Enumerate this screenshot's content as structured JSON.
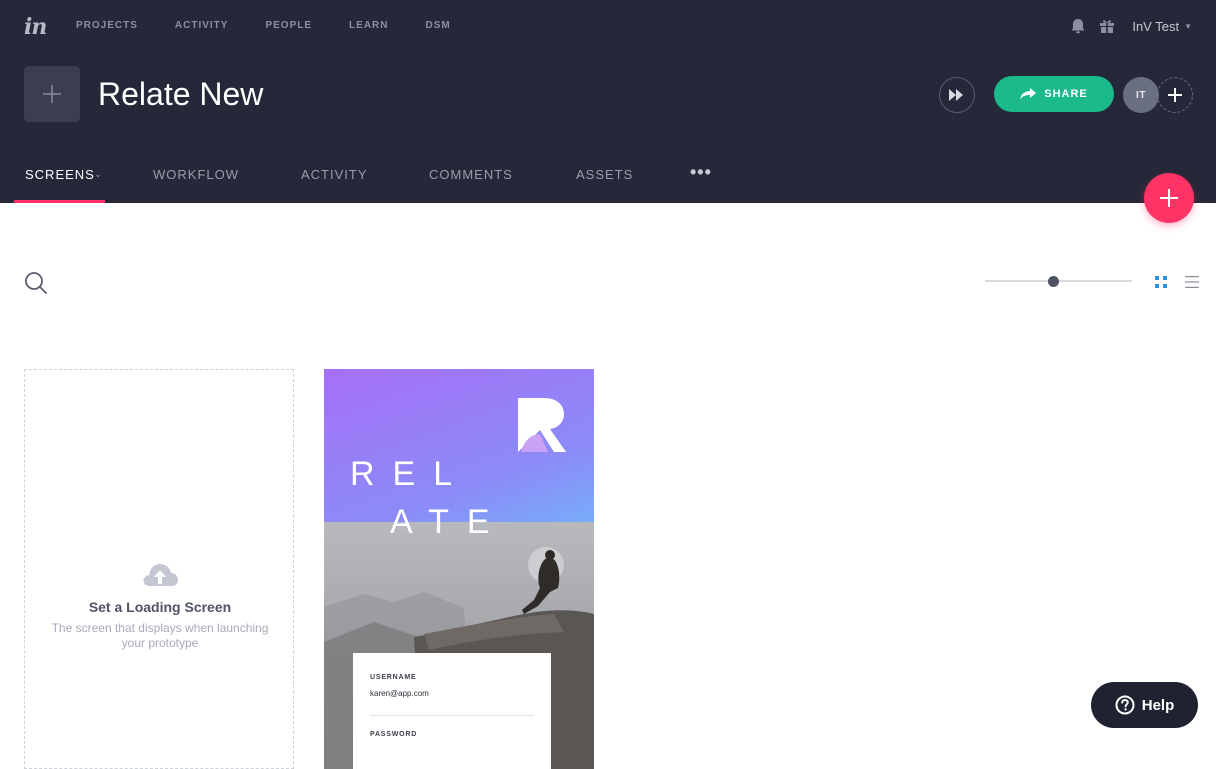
{
  "topbar": {
    "logo": "in",
    "nav": [
      "PROJECTS",
      "ACTIVITY",
      "PEOPLE",
      "LEARN",
      "DSM"
    ],
    "user_name": "InV Test"
  },
  "project": {
    "title": "Relate New",
    "share_label": "SHARE",
    "avatar_initials": "IT"
  },
  "tabs": [
    {
      "label": "SCREENS",
      "active": true
    },
    {
      "label": "WORKFLOW"
    },
    {
      "label": "ACTIVITY"
    },
    {
      "label": "COMMENTS"
    },
    {
      "label": "ASSETS"
    }
  ],
  "toolbar": {
    "zoom_level": 0.47,
    "view_mode": "grid"
  },
  "loading_card": {
    "title": "Set a Loading Screen",
    "subtitle": "The screen that displays when launching your prototype"
  },
  "screen_card": {
    "line1": "REL",
    "line2": "ATE",
    "username_label": "USERNAME",
    "username_value": "karen@app.com",
    "password_label": "PASSWORD"
  },
  "help": {
    "label": "Help"
  },
  "colors": {
    "header_bg": "#252838",
    "accent_pink": "#ff3366",
    "share_green": "#1aba8a",
    "grid_icon_blue": "#2f8fd8"
  }
}
